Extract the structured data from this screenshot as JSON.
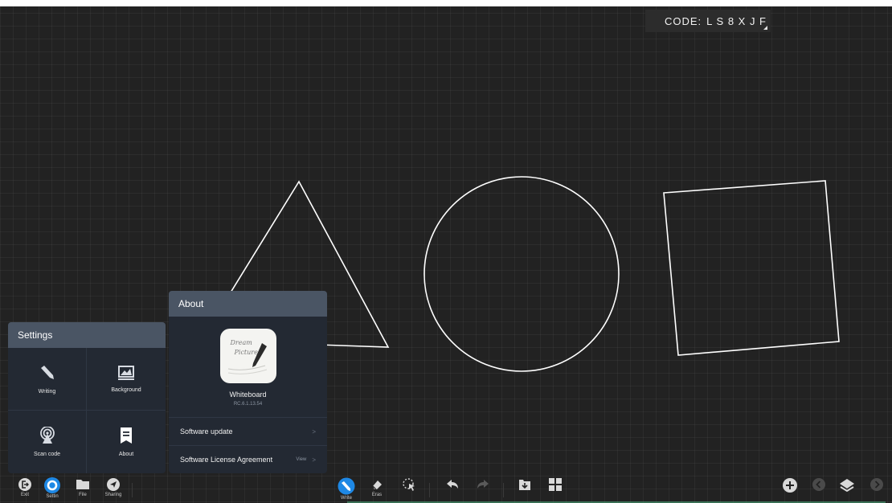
{
  "header": {
    "code_label": "CODE:",
    "code_value": "L S 8 X J F"
  },
  "canvas": {
    "shapes": [
      "triangle",
      "circle",
      "square"
    ],
    "stroke_color": "#ffffff"
  },
  "settings_panel": {
    "title": "Settings",
    "items": [
      {
        "label": "Writing",
        "icon": "pen-icon"
      },
      {
        "label": "Background",
        "icon": "background-image-icon"
      },
      {
        "label": "Scan code",
        "icon": "broadcast-icon"
      },
      {
        "label": "About",
        "icon": "document-icon"
      }
    ]
  },
  "about_panel": {
    "title": "About",
    "app_icon_text": [
      "Dream",
      "Picture"
    ],
    "app_name": "Whiteboard",
    "version": "RC.6.1.13.54",
    "rows": [
      {
        "label": "Software update",
        "action": ""
      },
      {
        "label": "Software License Agreement",
        "action": "View"
      }
    ]
  },
  "toolbar": {
    "left": [
      {
        "label": "Exit",
        "icon": "exit-icon"
      },
      {
        "label": "Settin",
        "icon": "settings-icon",
        "active": true
      },
      {
        "label": "File",
        "icon": "folder-icon"
      },
      {
        "label": "Sharing",
        "icon": "send-icon"
      }
    ],
    "center": [
      {
        "label": "Write",
        "icon": "pen-icon",
        "active": true
      },
      {
        "label": "Eras",
        "icon": "eraser-icon"
      },
      {
        "label": "",
        "icon": "select-icon"
      },
      {
        "label": "",
        "icon": "undo-icon"
      },
      {
        "label": "",
        "icon": "redo-icon"
      },
      {
        "label": "",
        "icon": "import-icon"
      },
      {
        "label": "",
        "icon": "grid-icon"
      }
    ],
    "right": [
      {
        "label": "",
        "icon": "add-page-icon"
      },
      {
        "label": "",
        "icon": "previous-page-icon"
      },
      {
        "label": "",
        "icon": "layers-icon"
      },
      {
        "label": "",
        "icon": "next-page-icon"
      }
    ]
  },
  "colors": {
    "accent": "#1e88e5",
    "panel_header": "#4a5564",
    "panel_body": "#232933",
    "board": "#222222"
  }
}
